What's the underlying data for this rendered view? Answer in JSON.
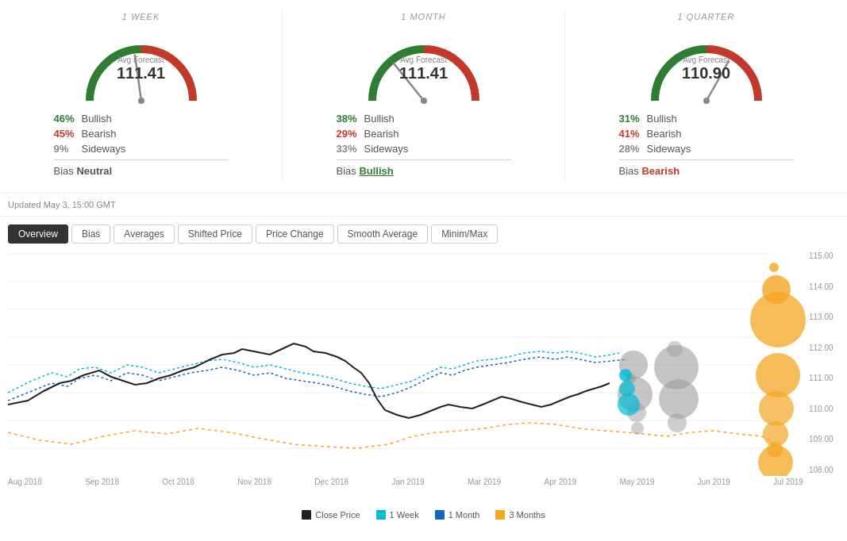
{
  "periods": [
    {
      "id": "1week",
      "label": "1 WEEK",
      "avg_label": "Avg Forecast",
      "value": "111.41",
      "bullish_pct": "46%",
      "bearish_pct": "45%",
      "sideways_pct": "9%",
      "bias_label": "Bias",
      "bias_value": "Neutral",
      "bias_class": "neutral",
      "needle_angle": -10
    },
    {
      "id": "1month",
      "label": "1 MONTH",
      "avg_label": "Avg Forecast",
      "value": "111.41",
      "bullish_pct": "38%",
      "bearish_pct": "29%",
      "sideways_pct": "33%",
      "bias_label": "Bias",
      "bias_value": "Bullish",
      "bias_class": "bullish",
      "needle_angle": -40
    },
    {
      "id": "1quarter",
      "label": "1 QUARTER",
      "avg_label": "Avg Forecast",
      "value": "110.90",
      "bullish_pct": "31%",
      "bearish_pct": "41%",
      "sideways_pct": "28%",
      "bias_label": "Bias",
      "bias_value": "Bearish",
      "bias_class": "bearish",
      "needle_angle": 20
    }
  ],
  "updated": "Updated May 3, 15:00 GMT",
  "tabs": [
    {
      "id": "overview",
      "label": "Overview",
      "active": true
    },
    {
      "id": "bias",
      "label": "Bias",
      "active": false
    },
    {
      "id": "averages",
      "label": "Averages",
      "active": false
    },
    {
      "id": "shifted",
      "label": "Shifted Price",
      "active": false
    },
    {
      "id": "pricechange",
      "label": "Price Change",
      "active": false
    },
    {
      "id": "smooth",
      "label": "Smooth Average",
      "active": false
    },
    {
      "id": "minmax",
      "label": "Minim/Max",
      "active": false
    }
  ],
  "y_axis": [
    "115.00",
    "114.00",
    "113.00",
    "112.00",
    "111.00",
    "110.00",
    "109.00",
    "108.00"
  ],
  "x_axis": [
    "Aug 2018",
    "Sep 2018",
    "Oct 2018",
    "Nov 2018",
    "Dec 2018",
    "Jan 2019",
    "Mar 2019",
    "Apr 2019",
    "May 2019",
    "Jun 2019",
    "Jul 2019"
  ],
  "legend": [
    {
      "label": "Close Price",
      "color": "#222"
    },
    {
      "label": "1 Week",
      "color": "#00bcd4"
    },
    {
      "label": "1 Month",
      "color": "#1565c0"
    },
    {
      "label": "3 Months",
      "color": "#f5a623"
    }
  ]
}
